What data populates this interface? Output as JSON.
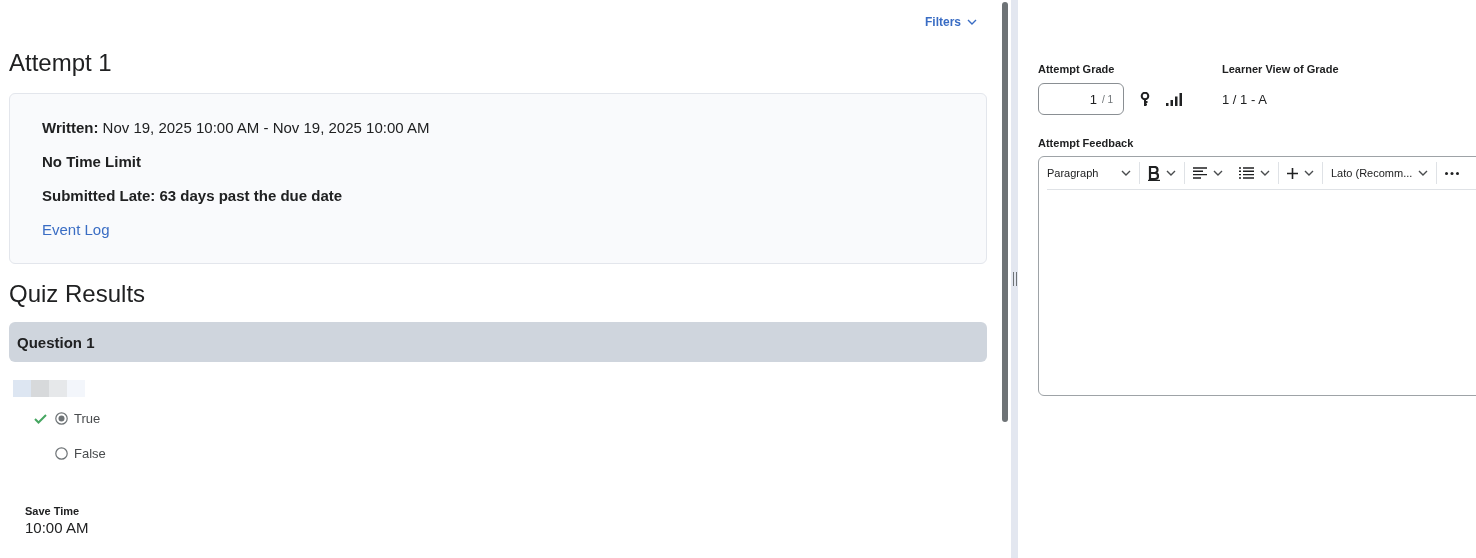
{
  "filters": {
    "label": "Filters"
  },
  "attempt": {
    "title": "Attempt 1",
    "written_label": "Written:",
    "written_value": "Nov 19, 2025 10:00 AM - Nov 19, 2025 10:00 AM",
    "time_limit": "No Time Limit",
    "submitted": "Submitted Late: 63 days past the due date",
    "event_log": "Event Log"
  },
  "quiz_results": {
    "title": "Quiz Results",
    "question": {
      "title": "Question 1",
      "options": [
        {
          "label": "True",
          "selected": true,
          "correct": true
        },
        {
          "label": "False",
          "selected": false,
          "correct": false
        }
      ]
    }
  },
  "save_time": {
    "label": "Save Time",
    "value": "10:00 AM"
  },
  "grade": {
    "label": "Attempt Grade",
    "value": "1",
    "out_of": "/ 1",
    "learner_view_label": "Learner View of Grade",
    "learner_view_value": "1 / 1 - A"
  },
  "feedback": {
    "label": "Attempt Feedback",
    "toolbar": {
      "format": "Paragraph",
      "font": "Lato (Recomm..."
    }
  }
}
